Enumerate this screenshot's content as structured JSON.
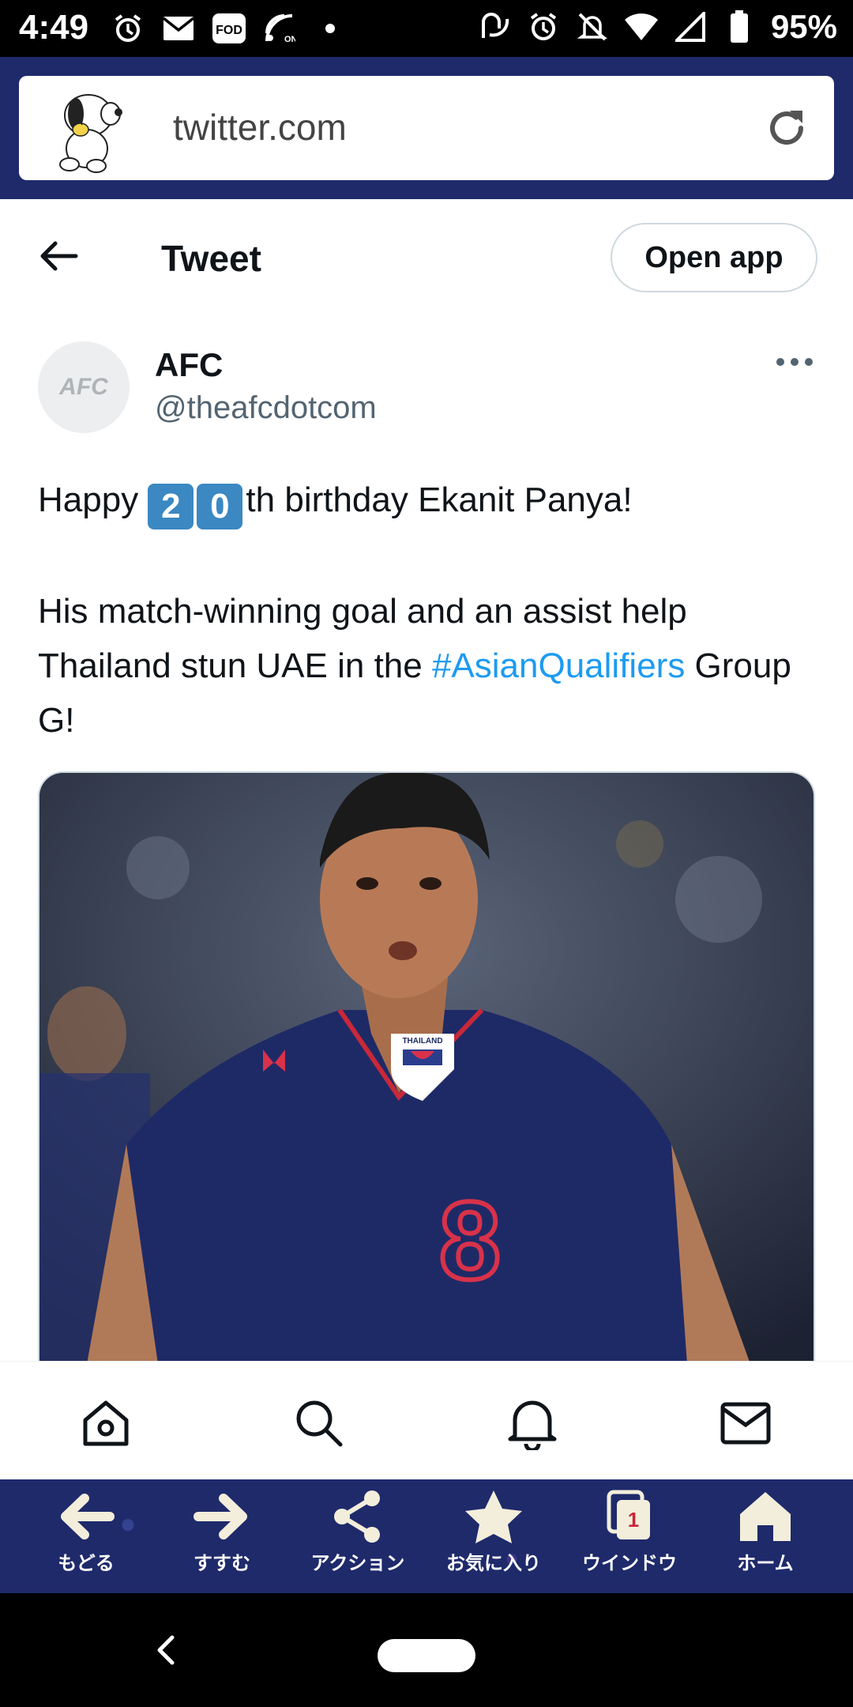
{
  "status_bar": {
    "time": "4:49",
    "battery": "95%",
    "left_icons": [
      "alarm-icon",
      "mail-icon",
      "fod-icon",
      "cast-icon",
      "dot-icon"
    ],
    "right_icons": [
      "nfc-icon",
      "alarm-icon",
      "mute-icon",
      "wifi-icon",
      "signal-icon",
      "battery-icon"
    ],
    "fod_label": "FOD"
  },
  "browser": {
    "url": "twitter.com"
  },
  "header": {
    "title": "Tweet",
    "open_app_label": "Open app"
  },
  "tweet": {
    "author_name": "AFC",
    "author_handle": "@theafcdotcom",
    "avatar_text": "AFC",
    "line1_prefix": "Happy ",
    "keycap_1": "2",
    "keycap_2": "0",
    "line1_suffix": "th birthday Ekanit Panya!",
    "para2_prefix": "His match-winning goal and an assist help Thailand stun UAE in the ",
    "hashtag": "#AsianQualifiers",
    "para2_suffix": " Group G!",
    "photo": {
      "shirt_number": "8",
      "crest_text": "THAILAND"
    }
  },
  "twitter_nav": [
    "home-icon",
    "search-icon",
    "bell-icon",
    "mail-icon"
  ],
  "browser_toolbar": {
    "back": "もどる",
    "forward": "すすむ",
    "action": "アクション",
    "favorites": "お気に入り",
    "window": "ウインドウ",
    "window_count": "1",
    "home": "ホーム"
  },
  "colors": {
    "link": "#1d9bf0",
    "keycap": "#3b88c3",
    "browser_bar": "#1f2a6b",
    "jersey": "#1e2a66"
  }
}
